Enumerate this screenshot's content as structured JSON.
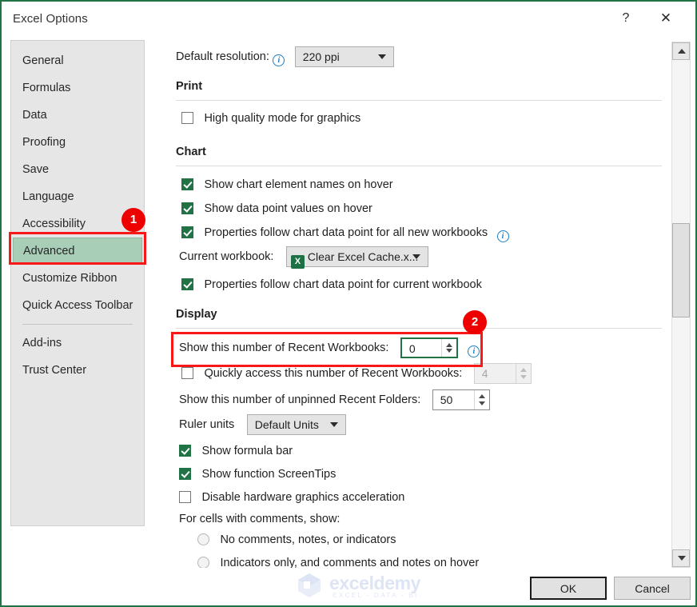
{
  "window": {
    "title": "Excel Options",
    "help_label": "?",
    "close_label": "✕"
  },
  "sidebar": {
    "items": [
      {
        "label": "General",
        "selected": false
      },
      {
        "label": "Formulas",
        "selected": false
      },
      {
        "label": "Data",
        "selected": false
      },
      {
        "label": "Proofing",
        "selected": false
      },
      {
        "label": "Save",
        "selected": false
      },
      {
        "label": "Language",
        "selected": false
      },
      {
        "label": "Accessibility",
        "selected": false
      },
      {
        "label": "Advanced",
        "selected": true
      },
      {
        "label": "Customize Ribbon",
        "selected": false
      },
      {
        "label": "Quick Access Toolbar",
        "selected": false
      },
      {
        "label": "Add-ins",
        "selected": false
      },
      {
        "label": "Trust Center",
        "selected": false
      }
    ]
  },
  "content": {
    "default_resolution": {
      "label": "Default resolution:",
      "value": "220 ppi"
    },
    "print": {
      "heading": "Print",
      "high_quality": {
        "label": "High quality mode for graphics",
        "checked": false
      }
    },
    "chart": {
      "heading": "Chart",
      "show_element_names": {
        "label": "Show chart element names on hover",
        "checked": true
      },
      "show_data_point_values": {
        "label": "Show data point values on hover",
        "checked": true
      },
      "props_all_new": {
        "label": "Properties follow chart data point for all new workbooks",
        "checked": true
      },
      "current_workbook": {
        "label": "Current workbook:",
        "value": "Clear Excel Cache.x...",
        "icon_letter": "X"
      },
      "props_current": {
        "label": "Properties follow chart data point for current workbook",
        "checked": true
      }
    },
    "display": {
      "heading": "Display",
      "recent_workbooks": {
        "label": "Show this number of Recent Workbooks:",
        "value": "0",
        "focused": true
      },
      "quick_access_recent": {
        "label": "Quickly access this number of Recent Workbooks:",
        "value": "4",
        "checked": false,
        "disabled": true
      },
      "unpinned_folders": {
        "label": "Show this number of unpinned Recent Folders:",
        "value": "50"
      },
      "ruler_units": {
        "label": "Ruler units",
        "value": "Default Units"
      },
      "show_formula_bar": {
        "label": "Show formula bar",
        "checked": true
      },
      "show_screentips": {
        "label": "Show function ScreenTips",
        "checked": true
      },
      "disable_hw_accel": {
        "label": "Disable hardware graphics acceleration",
        "checked": false
      },
      "comments_group": {
        "label": "For cells with comments, show:",
        "options": [
          {
            "label": "No comments, notes, or indicators",
            "selected": false
          },
          {
            "label": "Indicators only, and comments and notes on hover",
            "selected": false
          }
        ]
      }
    }
  },
  "footer": {
    "ok_label": "OK",
    "cancel_label": "Cancel"
  },
  "watermark": {
    "name": "exceldemy",
    "tagline": "EXCEL - DATA - BI"
  },
  "annotations": {
    "badge_1": "1",
    "badge_2": "2",
    "color": "#ee0000"
  }
}
